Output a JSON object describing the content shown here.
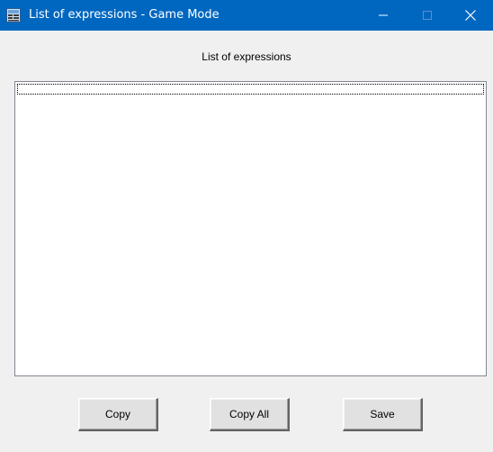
{
  "window": {
    "title": "List of expressions - Game Mode",
    "titlebar_color": "#0067c0",
    "icon": "app-window-icon"
  },
  "caption_buttons": {
    "minimize_icon": "minimize-icon",
    "maximize_icon": "maximize-icon",
    "close_icon": "close-icon"
  },
  "content": {
    "list_caption": "List of expressions",
    "expressions": []
  },
  "buttons": {
    "copy_label": "Copy",
    "copy_all_label": "Copy All",
    "save_label": "Save"
  }
}
